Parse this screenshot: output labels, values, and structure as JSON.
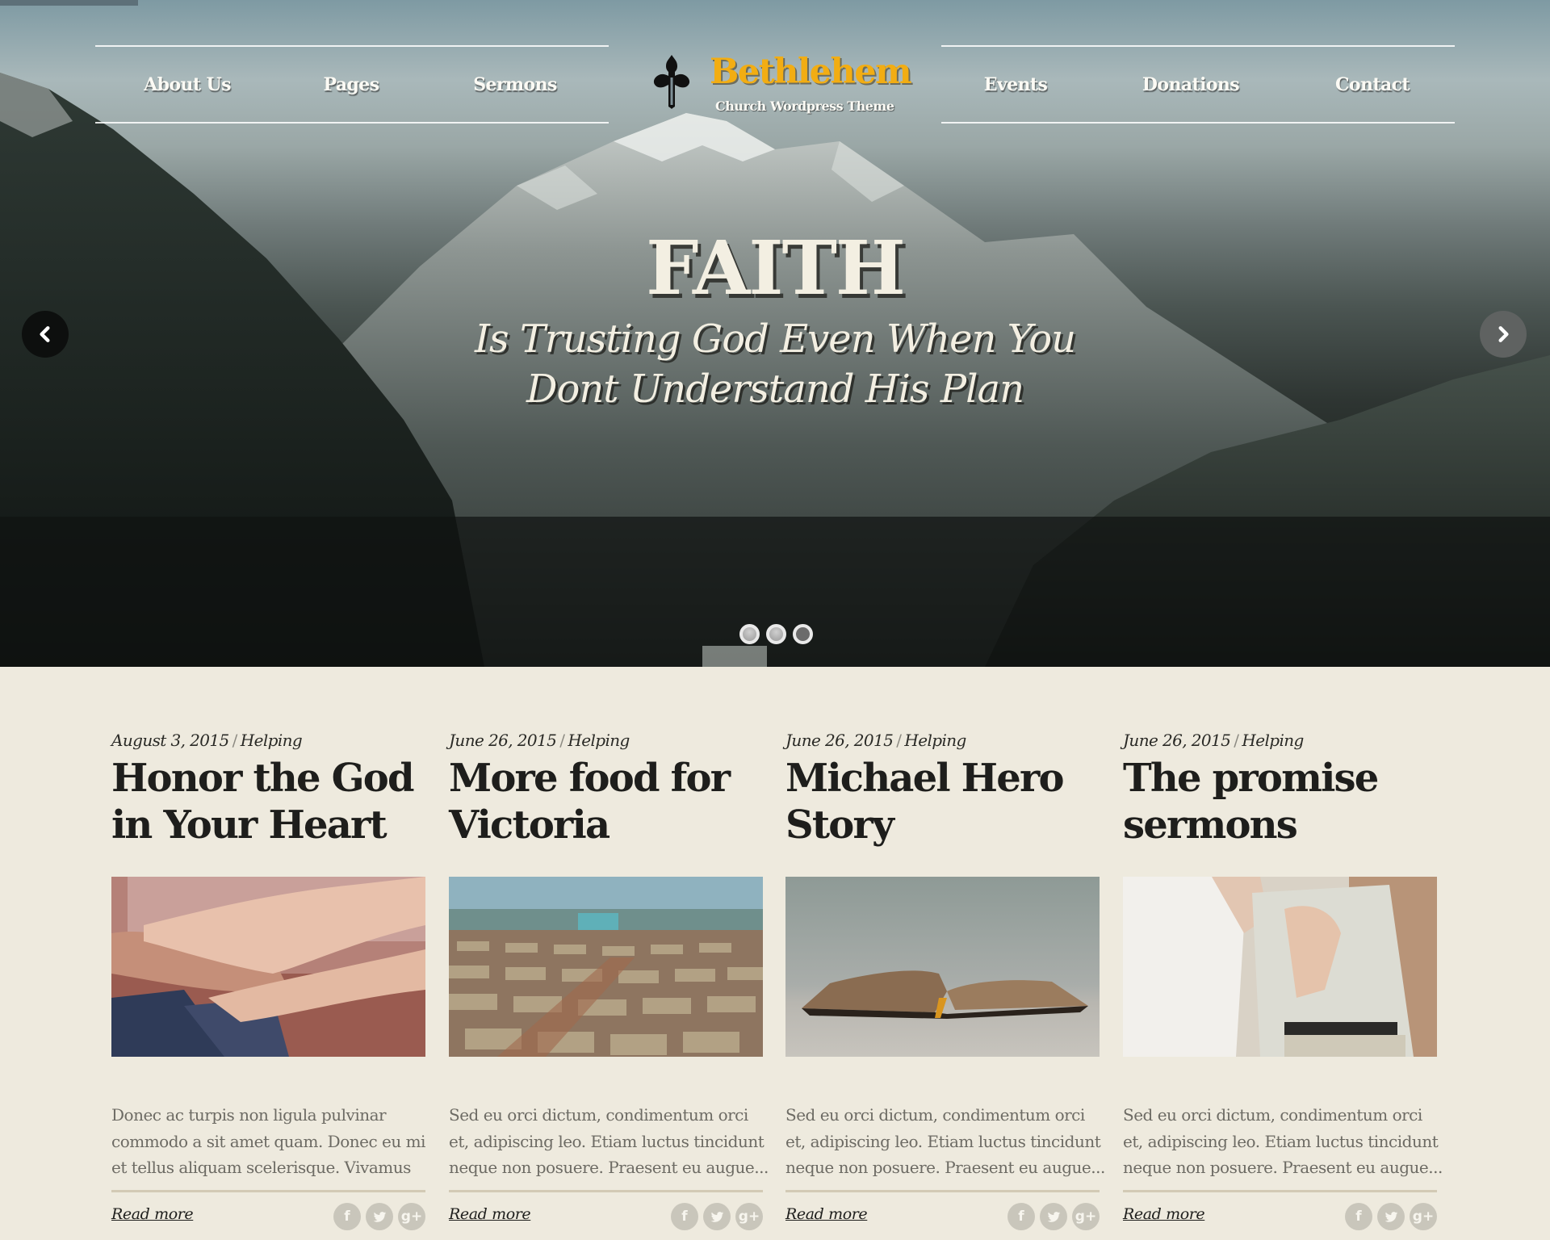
{
  "site": {
    "name": "Bethlehem",
    "tagline": "Church Wordpress Theme",
    "brand_color": "#f2ad13",
    "background_color": "#eeeade"
  },
  "nav": {
    "left": [
      {
        "label": "About Us"
      },
      {
        "label": "Pages"
      },
      {
        "label": "Sermons"
      }
    ],
    "right": [
      {
        "label": "Events"
      },
      {
        "label": "Donations"
      },
      {
        "label": "Contact"
      }
    ]
  },
  "slider": {
    "title": "FAITH",
    "subtitle_line1": "Is Trusting God Even When You",
    "subtitle_line2": "Dont Understand His Plan",
    "prev_icon": "chevron-left-icon",
    "next_icon": "chevron-right-icon",
    "slide_count": 3,
    "active_slide": 3
  },
  "posts": [
    {
      "date": "August 3, 2015",
      "category": "Helping",
      "title": "Honor the God in Your Heart",
      "image_subject": "holding-hands",
      "excerpt": "Donec ac turpis non ligula pulvinar commodo a sit amet quam. Donec eu mi et tellus aliquam scelerisque. Vivamus",
      "read_more": "Read more"
    },
    {
      "date": "June 26, 2015",
      "category": "Helping",
      "title": "More food for Victoria",
      "image_subject": "refugee-camp-tents",
      "excerpt": "Sed eu orci dictum, condimentum orci et, adipiscing leo. Etiam luctus tincidunt neque non posuere. Praesent eu augue...",
      "read_more": "Read more"
    },
    {
      "date": "June 26, 2015",
      "category": "Helping",
      "title": "Michael Hero Story",
      "image_subject": "open-bible",
      "excerpt": "Sed eu orci dictum, condimentum orci et, adipiscing leo. Etiam luctus tincidunt neque non posuere. Praesent eu augue...",
      "read_more": "Read more"
    },
    {
      "date": "June 26, 2015",
      "category": "Helping",
      "title": "The promise sermons",
      "image_subject": "elderly-couple-dancing",
      "excerpt": "Sed eu orci dictum, condimentum orci et, adipiscing leo. Etiam luctus tincidunt neque non posuere. Praesent eu augue...",
      "read_more": "Read more"
    }
  ],
  "social": {
    "icons": [
      "facebook-icon",
      "twitter-icon",
      "google-plus-icon"
    ],
    "facebook_glyph": "f",
    "google_glyph": "g+"
  },
  "meta_separator": "/"
}
